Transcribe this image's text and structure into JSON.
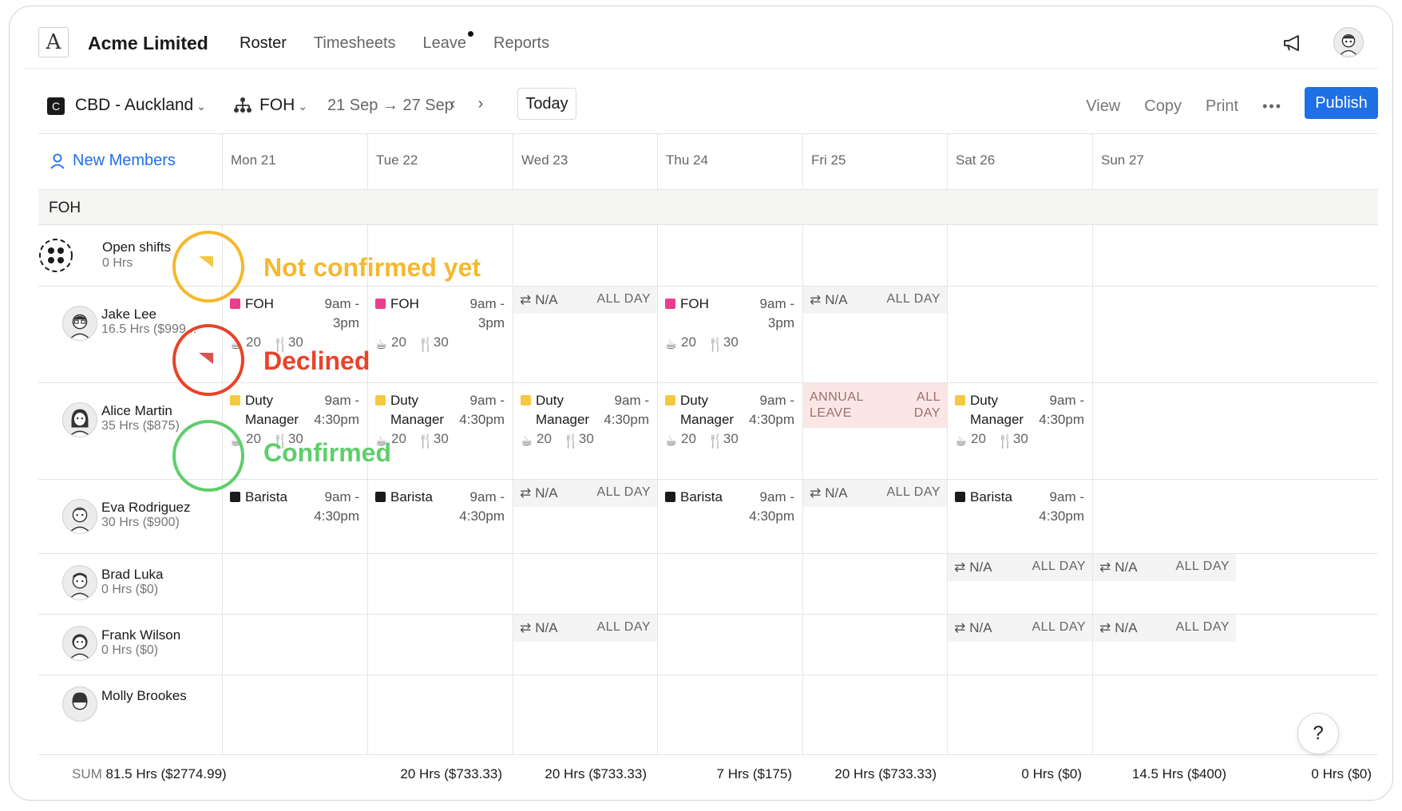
{
  "app": {
    "company": "Acme Limited",
    "logo_letter": "A",
    "nav": [
      "Roster",
      "Timesheets",
      "Leave",
      "Reports"
    ]
  },
  "toolbar": {
    "location_badge": "C",
    "location": "CBD - Auckland",
    "team": "FOH",
    "range": "21 Sep → 27 Sep",
    "prev": "‹",
    "next": "›",
    "today": "Today",
    "view": "View",
    "copy": "Copy",
    "print": "Print",
    "more": "•••",
    "publish": "Publish"
  },
  "grid": {
    "new_members": "New Members",
    "days": [
      "Mon 21",
      "Tue 22",
      "Wed 23",
      "Thu 24",
      "Fri 25",
      "Sat 26",
      "Sun 27"
    ],
    "group": "FOH",
    "help": "?"
  },
  "colors": {
    "foh": "#e83e8c",
    "duty": "#f5c842",
    "barista": "#1a1a1a",
    "publish": "#1f6fe5",
    "not_confirmed": "#f5b82e",
    "declined": "#e8432a",
    "confirmed": "#5fce6b"
  },
  "people": [
    {
      "name": "Open shifts",
      "hours": "0 Hrs"
    },
    {
      "name": "Jake Lee",
      "hours": "16.5 Hrs ($999..."
    },
    {
      "name": "Alice Martin",
      "hours": "35 Hrs ($875)"
    },
    {
      "name": "Eva Rodriguez",
      "hours": "30 Hrs ($900)"
    },
    {
      "name": "Brad Luka",
      "hours": "0 Hrs ($0)"
    },
    {
      "name": "Frank Wilson",
      "hours": "0 Hrs ($0)"
    },
    {
      "name": "Molly Brookes",
      "hours": ""
    }
  ],
  "shift_text": {
    "foh": "FOH",
    "duty_1": "Duty",
    "duty_2": "Manager",
    "barista": "Barista",
    "start": "9am -",
    "end_3pm": "3pm",
    "end_430": "4:30pm",
    "meta_a": "20",
    "meta_b": "30",
    "na": "N/A",
    "all_day": "ALL DAY",
    "all": "ALL",
    "day": "DAY",
    "annual": "ANNUAL",
    "leave": "LEAVE"
  },
  "sums": {
    "label": "SUM",
    "total": "81.5 Hrs ($2774.99)",
    "days": [
      "20 Hrs ($733.33)",
      "20 Hrs ($733.33)",
      "7 Hrs ($175)",
      "20 Hrs ($733.33)",
      "0 Hrs ($0)",
      "14.5 Hrs ($400)",
      "0 Hrs ($0)"
    ]
  },
  "annotations": {
    "not_confirmed": "Not confirmed yet",
    "declined": "Declined",
    "confirmed": "Confirmed"
  }
}
